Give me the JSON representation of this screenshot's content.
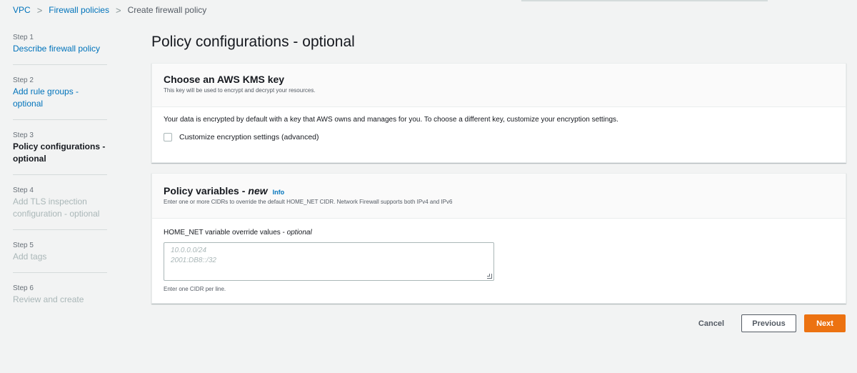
{
  "breadcrumb": {
    "items": [
      "VPC",
      "Firewall policies"
    ],
    "separator": ">",
    "current": "Create firewall policy"
  },
  "steps": [
    {
      "num": "Step 1",
      "label": "Describe firewall policy",
      "state": "link"
    },
    {
      "num": "Step 2",
      "label": "Add rule groups - optional",
      "state": "link"
    },
    {
      "num": "Step 3",
      "label": "Policy configurations - optional",
      "state": "current"
    },
    {
      "num": "Step 4",
      "label": "Add TLS inspection configuration - optional",
      "state": "disabled"
    },
    {
      "num": "Step 5",
      "label": "Add tags",
      "state": "disabled"
    },
    {
      "num": "Step 6",
      "label": "Review and create",
      "state": "disabled"
    }
  ],
  "page": {
    "title": "Policy configurations - optional"
  },
  "kms": {
    "title": "Choose an AWS KMS key",
    "description": "This key will be used to encrypt and decrypt your resources.",
    "body": "Your data is encrypted by default with a key that AWS owns and manages for you. To choose a different key, customize your encryption settings.",
    "checkbox_label": "Customize encryption settings (advanced)",
    "checkbox_checked": false
  },
  "variables": {
    "title": "Policy variables -",
    "new_tag": "new",
    "info": "Info",
    "description": "Enter one or more CIDRs to override the default HOME_NET CIDR. Network Firewall supports both IPv4 and IPv6",
    "field_label": "HOME_NET variable override values -",
    "field_optional": "optional",
    "placeholder_line1": "10.0.0.0/24",
    "placeholder_line2": "2001:DB8::/32",
    "value": "",
    "help": "Enter one CIDR per line."
  },
  "actions": {
    "cancel": "Cancel",
    "previous": "Previous",
    "next": "Next"
  },
  "colors": {
    "accent": "#ec7211",
    "link": "#0073bb",
    "background": "#f2f3f3"
  }
}
